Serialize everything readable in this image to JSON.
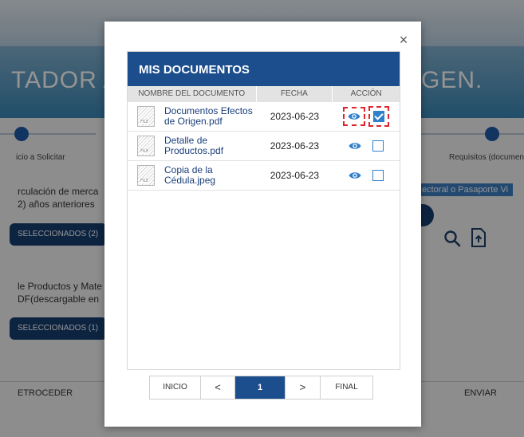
{
  "background": {
    "title_left": "TADOR A",
    "title_right": "GEN.",
    "steps": {
      "step1_label": "icio a Solicitar",
      "step4_label": "Requisitos (documen"
    },
    "section1_line1": "rculación de merca",
    "section1_line2": "2) años anteriores",
    "section1_button": "SELECCIONADOS (2)",
    "section1_link": "ectoral o Pasaporte Vi",
    "section2_line1": "le Productos y Mate",
    "section2_line2": "DF(descargable en",
    "section2_button": "SELECCIONADOS (1)",
    "footer_back": "ETROCEDER",
    "footer_send": "ENVIAR"
  },
  "modal": {
    "close_label": "×",
    "title": "MIS DOCUMENTOS",
    "columns": {
      "document": "NOMBRE DEL DOCUMENTO",
      "date": "FECHA",
      "action": "ACCIÓN"
    },
    "file_icon_text": "FILE",
    "documents": [
      {
        "name_line1": "Documentos Efectos",
        "name_line2": "de Origen.pdf",
        "date": "2023-06-23",
        "selected": true
      },
      {
        "name_line1": "Detalle de",
        "name_line2": "Productos.pdf",
        "date": "2023-06-23",
        "selected": false
      },
      {
        "name_line1": "Copia de la",
        "name_line2": "Cédula.jpeg",
        "date": "2023-06-23",
        "selected": false
      }
    ],
    "pagination": {
      "start": "INICIO",
      "prev": "<",
      "current": "1",
      "next": ">",
      "end": "FINAL"
    }
  },
  "colors": {
    "primary": "#1c4d8c",
    "checkbox": "#2f7fc9",
    "highlight": "#e0242b"
  }
}
